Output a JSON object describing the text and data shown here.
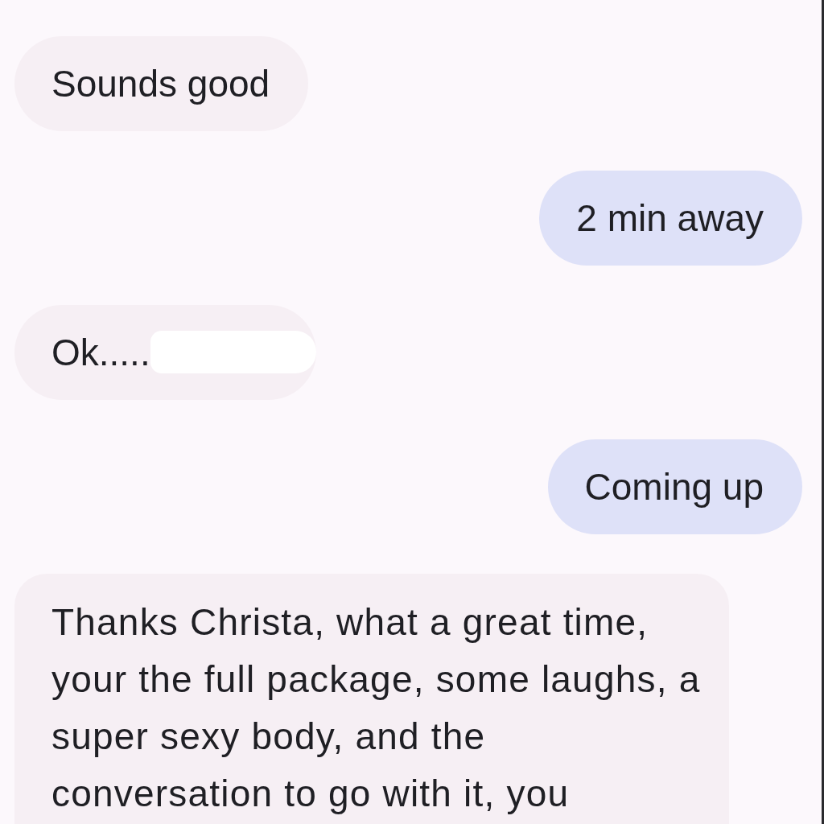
{
  "messages": [
    {
      "kind": "incoming",
      "lines": [
        "Sounds good"
      ],
      "redacted": false
    },
    {
      "kind": "outgoing",
      "lines": [
        "2 min away"
      ],
      "redacted": false
    },
    {
      "kind": "incoming",
      "lines": [
        "Ok....."
      ],
      "redacted": true
    },
    {
      "kind": "outgoing",
      "lines": [
        "Coming up"
      ],
      "redacted": false
    },
    {
      "kind": "incoming",
      "lines": [
        "Thanks Christa, what a great time,",
        "your the full package, some laughs, a",
        "super sexy body, and the",
        "conversation to go with it, you"
      ],
      "redacted": false
    }
  ]
}
